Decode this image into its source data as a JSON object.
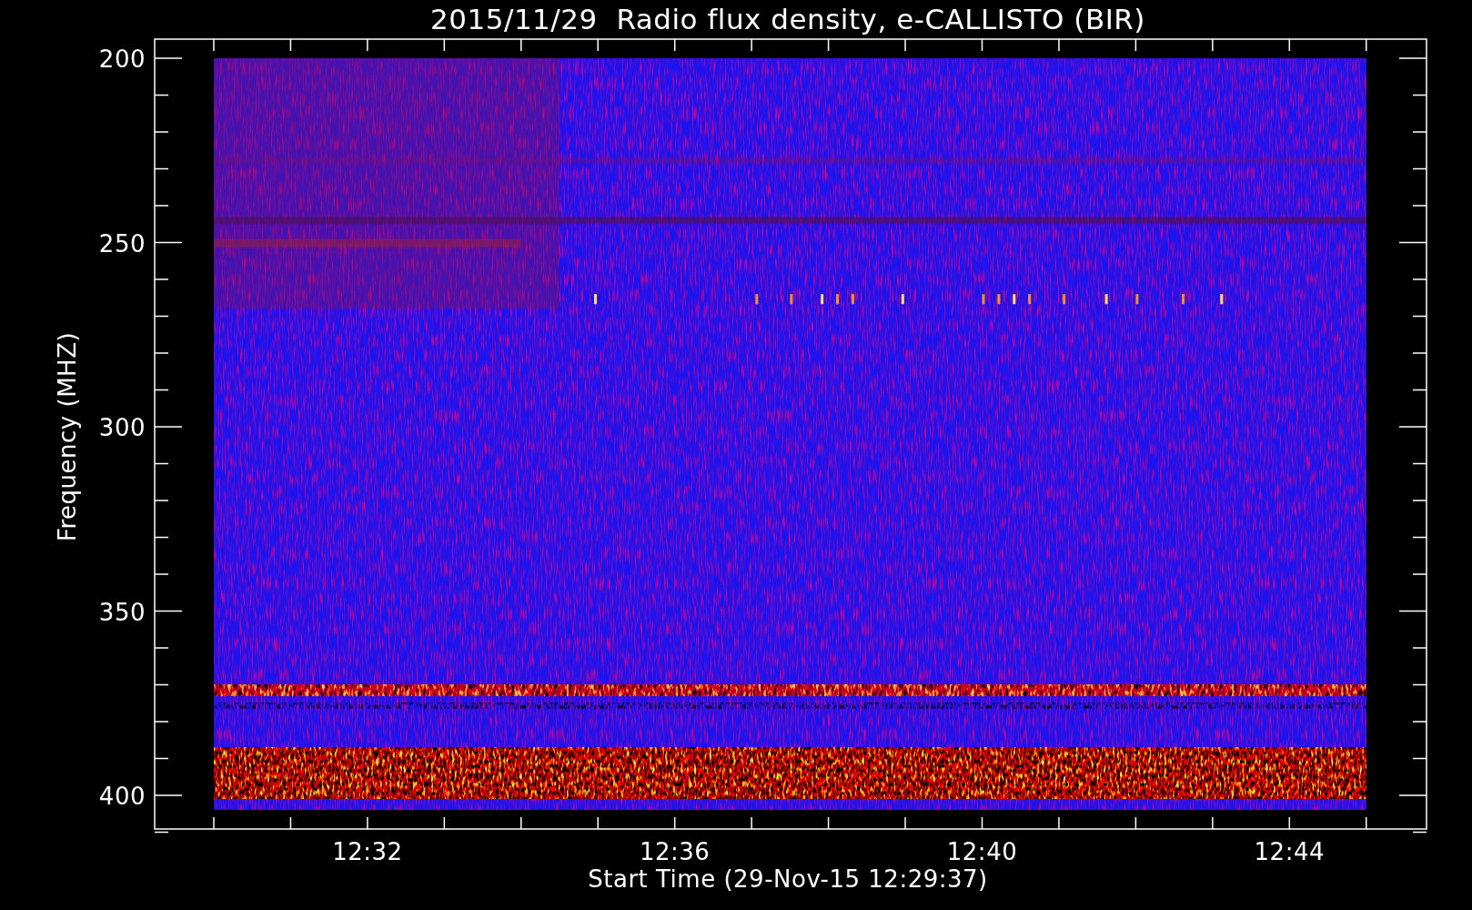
{
  "title": "2015/11/29  Radio flux density, e-CALLISTO (BIR)",
  "y_axis": {
    "label": "Frequency (MHZ)",
    "ticks": [
      "200",
      "250",
      "300",
      "350",
      "400"
    ]
  },
  "x_axis": {
    "label": "Start Time (29-Nov-15 12:29:37)",
    "ticks": [
      "12:32",
      "12:36",
      "12:40",
      "12:44"
    ]
  }
}
